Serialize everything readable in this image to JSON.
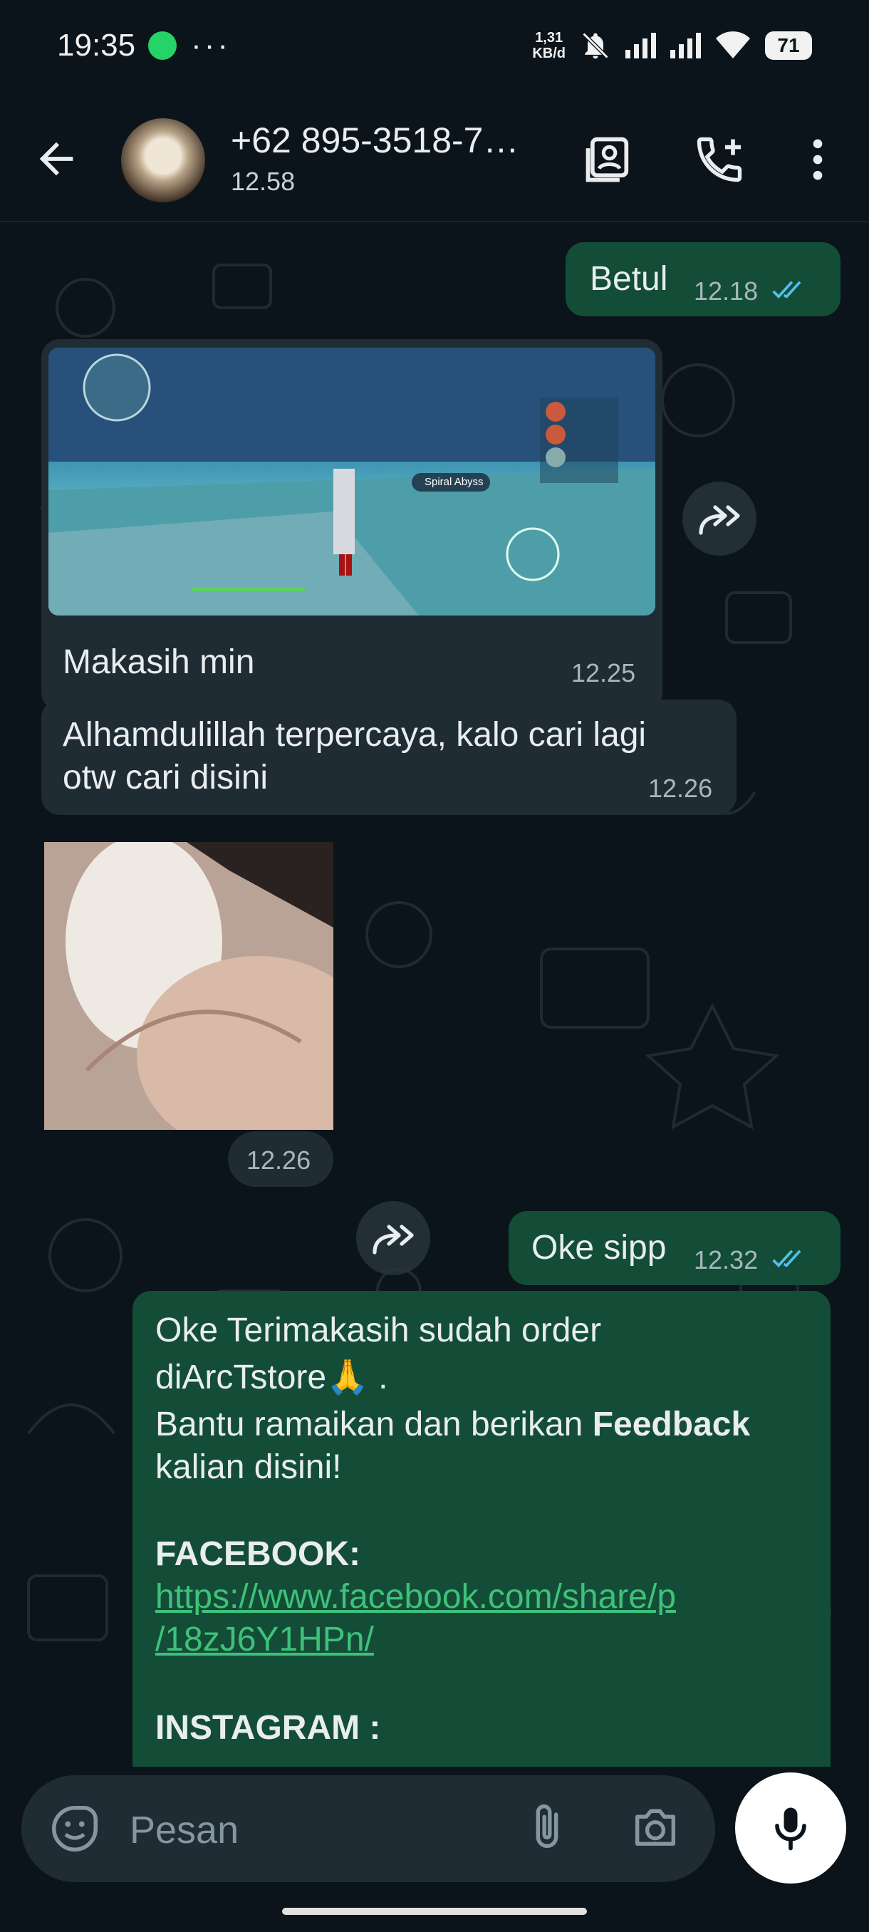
{
  "status_bar": {
    "time": "19:35",
    "dots": "···",
    "net_speed_top": "1,31",
    "net_speed_bottom": "KB/d",
    "battery": "71"
  },
  "header": {
    "contact": "+62 895-3518-7…",
    "subtitle": "12.58"
  },
  "messages": [
    {
      "dir": "out",
      "text": "Betul",
      "time": "12.18",
      "status": "read"
    },
    {
      "dir": "in",
      "type": "image",
      "caption": "Makasih min",
      "time": "12.25",
      "image_label": "Spiral Abyss"
    },
    {
      "dir": "in",
      "text_line1": "Alhamdulillah terpercaya, kalo cari lagi",
      "text_line2": "otw cari disini",
      "time": "12.26"
    },
    {
      "dir": "in",
      "type": "sticker",
      "time": "12.26"
    },
    {
      "dir": "out",
      "text": "Oke sipp",
      "time": "12.32",
      "status": "read"
    },
    {
      "dir": "out",
      "line1": "Oke Terimakasih sudah order",
      "line2": "diArcTstore",
      "emoji": "🙏",
      "line2_end": " .",
      "line3_start": "Bantu ramaikan dan berikan ",
      "line3_bold": "Feedback",
      "line4": "kalian disini!",
      "fb_label": "FACEBOOK:",
      "fb_link_1": "https://www.facebook.com/share/p",
      "fb_link_2": "/18zJ6Y1HPn/",
      "ig_label": "INSTAGRAM :"
    }
  ],
  "composer": {
    "placeholder": "Pesan"
  },
  "colors": {
    "background": "#0b141a",
    "outgoing_bubble": "#134d37",
    "incoming_bubble": "#1f2c34",
    "read_ticks": "#53bdeb",
    "link": "#3ec27a"
  }
}
